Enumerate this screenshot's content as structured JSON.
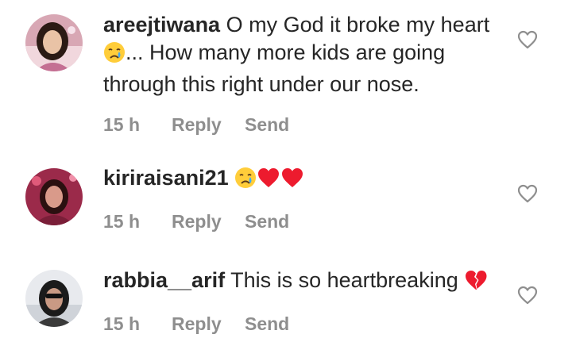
{
  "comments": [
    {
      "username": "areejtiwana",
      "text_before_emoji": "O my God it broke my heart",
      "emoji_1": "crying-face",
      "text_after_emoji": "... How many more kids are going through this right under our nose.",
      "time": "15 h",
      "reply_label": "Reply",
      "send_label": "Send",
      "avatar_palette": {
        "bg": "#d8a7b4",
        "hair": "#2b1a14",
        "skin": "#e9c3a6",
        "cloth": "#c46f93"
      }
    },
    {
      "username": "kiriraisani21",
      "text": "",
      "emojis": [
        "crying-face",
        "red-heart",
        "red-heart"
      ],
      "time": "15 h",
      "reply_label": "Reply",
      "send_label": "Send",
      "avatar_palette": {
        "bg": "#9b2a4a",
        "hair": "#2b1010",
        "skin": "#d99a8a",
        "cloth": "#7a1e38"
      }
    },
    {
      "username": "rabbia__arif",
      "text": "This is so heartbreaking",
      "emojis": [
        "broken-heart"
      ],
      "time": "15 h",
      "reply_label": "Reply",
      "send_label": "Send",
      "avatar_palette": {
        "bg": "#e8eaee",
        "hair": "#1b1b1b",
        "skin": "#c99a84",
        "cloth": "#3a3a3a"
      }
    }
  ],
  "colors": {
    "text": "#262626",
    "meta": "#8e8e8e",
    "heart_red": "#ed1b2e",
    "emoji_yellow": "#ffcd3a",
    "tear_blue": "#3fa9f5"
  }
}
